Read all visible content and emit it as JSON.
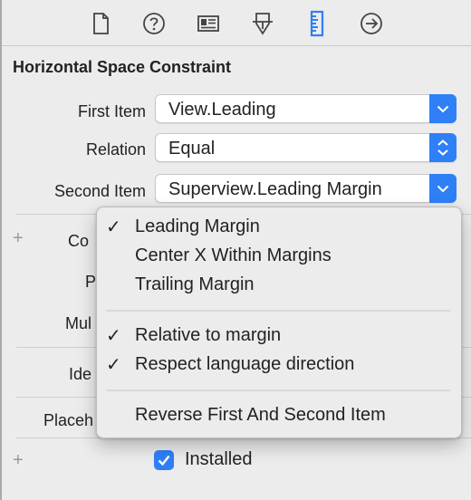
{
  "toolbar": {
    "icons": [
      "file-inspector-icon",
      "quick-help-icon",
      "identity-inspector-icon",
      "attributes-inspector-icon",
      "size-inspector-icon",
      "connections-inspector-icon"
    ],
    "selected": "size-inspector-icon",
    "accent": "#2f7ff6"
  },
  "section_title": "Horizontal Space Constraint",
  "fields": {
    "first_item": {
      "label": "First Item",
      "value": "View.Leading"
    },
    "relation": {
      "label": "Relation",
      "value": "Equal"
    },
    "second_item": {
      "label": "Second Item",
      "value": "Superview.Leading Margin"
    }
  },
  "partial_labels": {
    "constant": "Co",
    "priority": "P",
    "multiplier": "Mul",
    "identifier": "Ide",
    "placeholder": "Placeh"
  },
  "plus_symbol": "+",
  "menu": {
    "items": [
      {
        "label": "Leading Margin",
        "checked": true
      },
      {
        "label": "Center X Within Margins",
        "checked": false
      },
      {
        "label": "Trailing Margin",
        "checked": false
      },
      {
        "label": "Relative to margin",
        "checked": true
      },
      {
        "label": "Respect language direction",
        "checked": true
      },
      {
        "label": "Reverse First And Second Item",
        "checked": false
      }
    ],
    "check_glyph": "✓"
  },
  "installed": {
    "label": "Installed",
    "checked": true
  }
}
